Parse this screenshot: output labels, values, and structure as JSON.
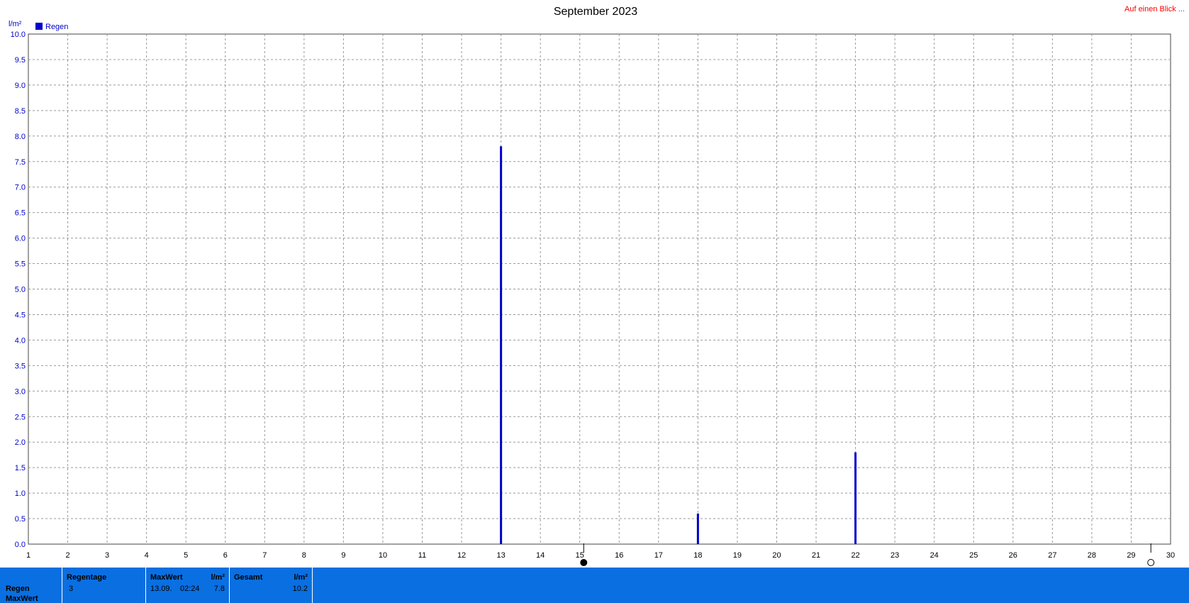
{
  "header": {
    "title": "September 2023",
    "link_label": "Auf einen Blick ..."
  },
  "colors": {
    "series": "#0000cc",
    "grid": "#999999",
    "panel": "#0a6fe0",
    "link": "#ff0000"
  },
  "chart_data": {
    "type": "bar",
    "title": "September 2023",
    "ylabel": "l/m²",
    "xlabel": "",
    "ylim": [
      0,
      10
    ],
    "xlim": [
      1,
      30
    ],
    "yticks": [
      "0.0",
      "0.5",
      "1.0",
      "1.5",
      "2.0",
      "2.5",
      "3.0",
      "3.5",
      "4.0",
      "4.5",
      "5.0",
      "5.5",
      "6.0",
      "6.5",
      "7.0",
      "7.5",
      "8.0",
      "8.5",
      "9.0",
      "9.5",
      "10.0"
    ],
    "xticks": [
      "1",
      "2",
      "3",
      "4",
      "5",
      "6",
      "7",
      "8",
      "9",
      "10",
      "11",
      "12",
      "13",
      "14",
      "15",
      "16",
      "17",
      "18",
      "19",
      "20",
      "21",
      "22",
      "23",
      "24",
      "25",
      "26",
      "27",
      "28",
      "29",
      "30"
    ],
    "grid": true,
    "legend_position": "top-left",
    "series": [
      {
        "name": "Regen",
        "x": [
          13,
          18,
          22
        ],
        "values": [
          7.8,
          0.6,
          1.8
        ]
      }
    ],
    "markers": [
      {
        "day": 15.1,
        "icon": "new-moon-icon"
      },
      {
        "day": 29.5,
        "icon": "full-moon-icon"
      }
    ]
  },
  "stats": {
    "row_labels": [
      "Regen",
      "MaxWert"
    ],
    "regentage": {
      "header": "Regentage",
      "value": "3"
    },
    "maxwert": {
      "header": "MaxWert",
      "unit": "l/m²",
      "date": "13.09.",
      "time": "02:24",
      "value": "7.8"
    },
    "gesamt": {
      "header": "Gesamt",
      "unit": "l/m²",
      "value": "10.2"
    }
  }
}
